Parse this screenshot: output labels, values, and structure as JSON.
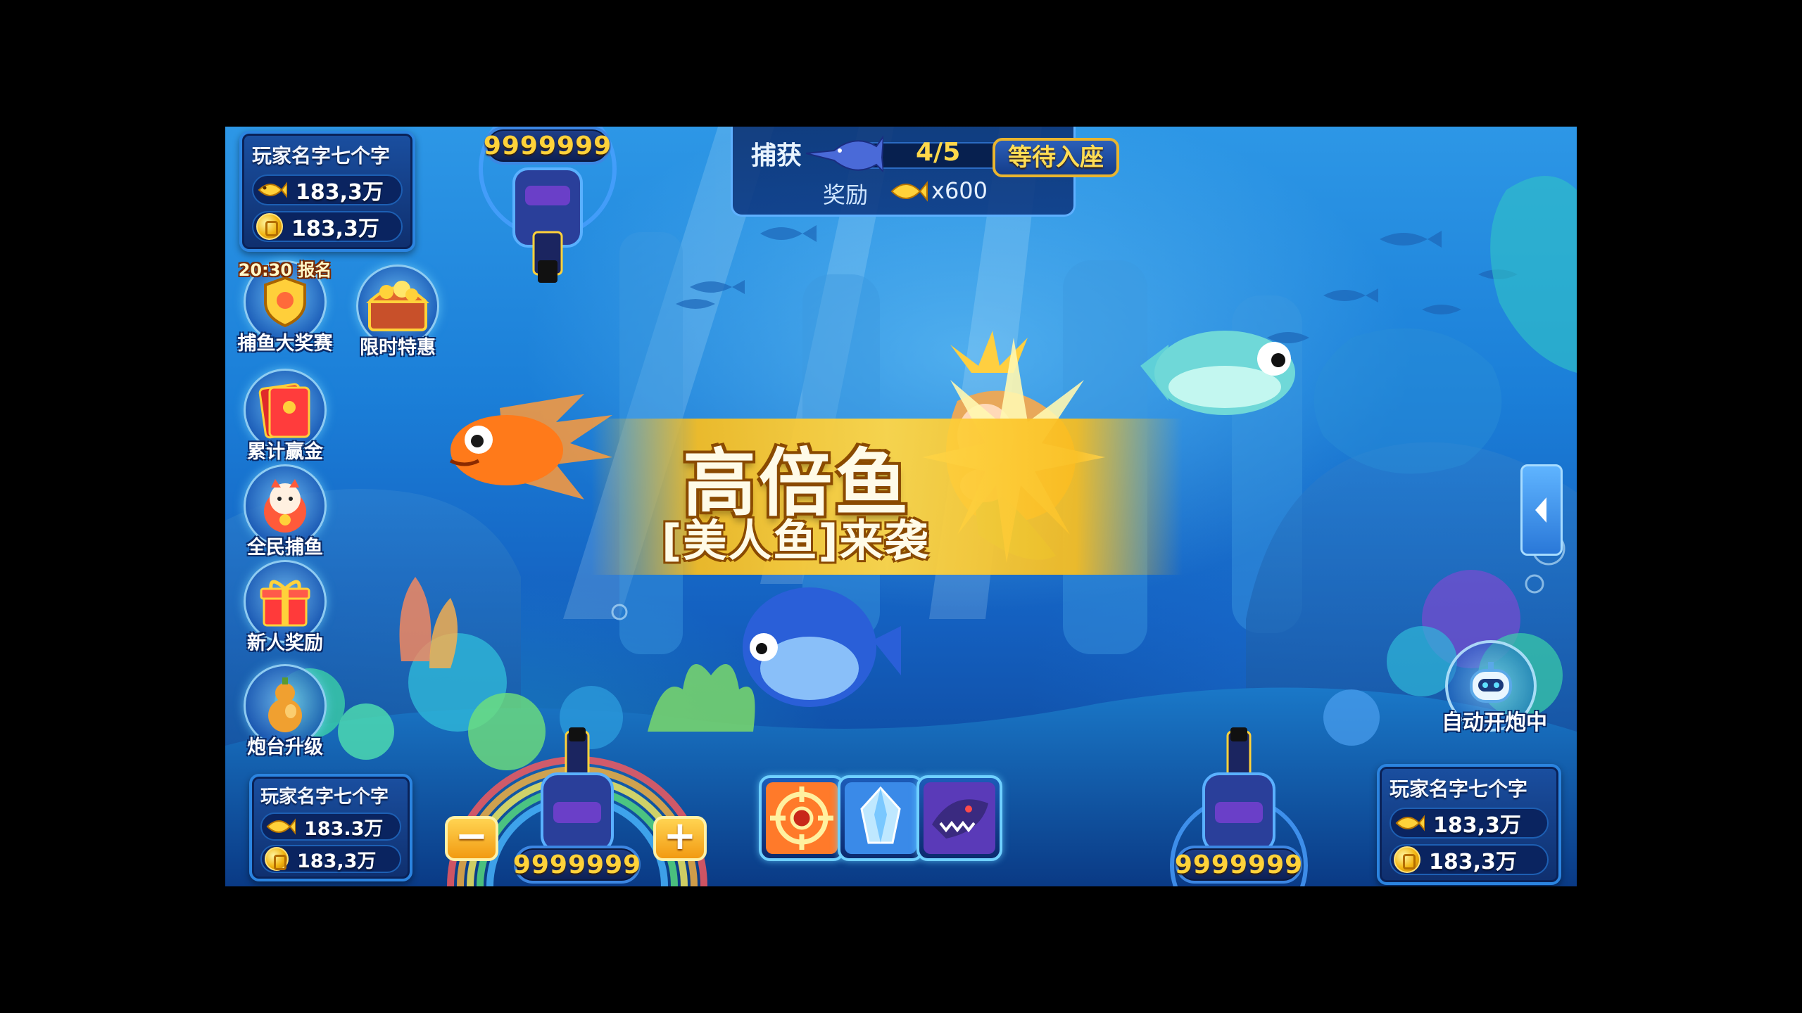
{
  "players": {
    "top_left": {
      "name": "玩家名字七个字",
      "fish": "183,3万",
      "coins": "183,3万"
    },
    "bottom_left": {
      "name": "玩家名字七个字",
      "fish": "183.3万",
      "coins": "183,3万"
    },
    "bottom_right": {
      "name": "玩家名字七个字",
      "fish": "183,3万",
      "coins": "183,3万"
    }
  },
  "cannons": {
    "top": {
      "value": "9999999"
    },
    "bottom_left": {
      "value": "9999999"
    },
    "bottom_right": {
      "value": "9999999"
    }
  },
  "bet_controls": {
    "minus": "−",
    "plus": "+"
  },
  "capture": {
    "label": "捕获",
    "count": "4/5",
    "reward_label": "奖励",
    "reward_value": "x600"
  },
  "wait_seat": "等待入座",
  "side_menu": [
    {
      "label": "捕鱼大奖赛",
      "badge": "20:30 报名",
      "icon": "trophy-shield-icon"
    },
    {
      "label": "限时特惠",
      "icon": "treasure-chest-icon"
    },
    {
      "label": "累计赢金",
      "icon": "red-envelope-icon"
    },
    {
      "label": "全民捕鱼",
      "icon": "lucky-cat-icon"
    },
    {
      "label": "新人奖励",
      "icon": "gift-box-icon"
    },
    {
      "label": "炮台升级",
      "icon": "gourd-icon"
    }
  ],
  "banner": {
    "title": "高倍鱼",
    "subtitle": "[美人鱼]来袭"
  },
  "skills": [
    {
      "icon": "crosshair-lock-icon"
    },
    {
      "icon": "ice-crystal-icon"
    },
    {
      "icon": "shark-frenzy-icon"
    }
  ],
  "auto_fire": {
    "label": "自动开炮中",
    "icon": "robot-icon"
  },
  "colors": {
    "accent_gold": "#ffd23a",
    "panel_blue": "#0f2f6e",
    "ocean": "#1b7fd8"
  }
}
